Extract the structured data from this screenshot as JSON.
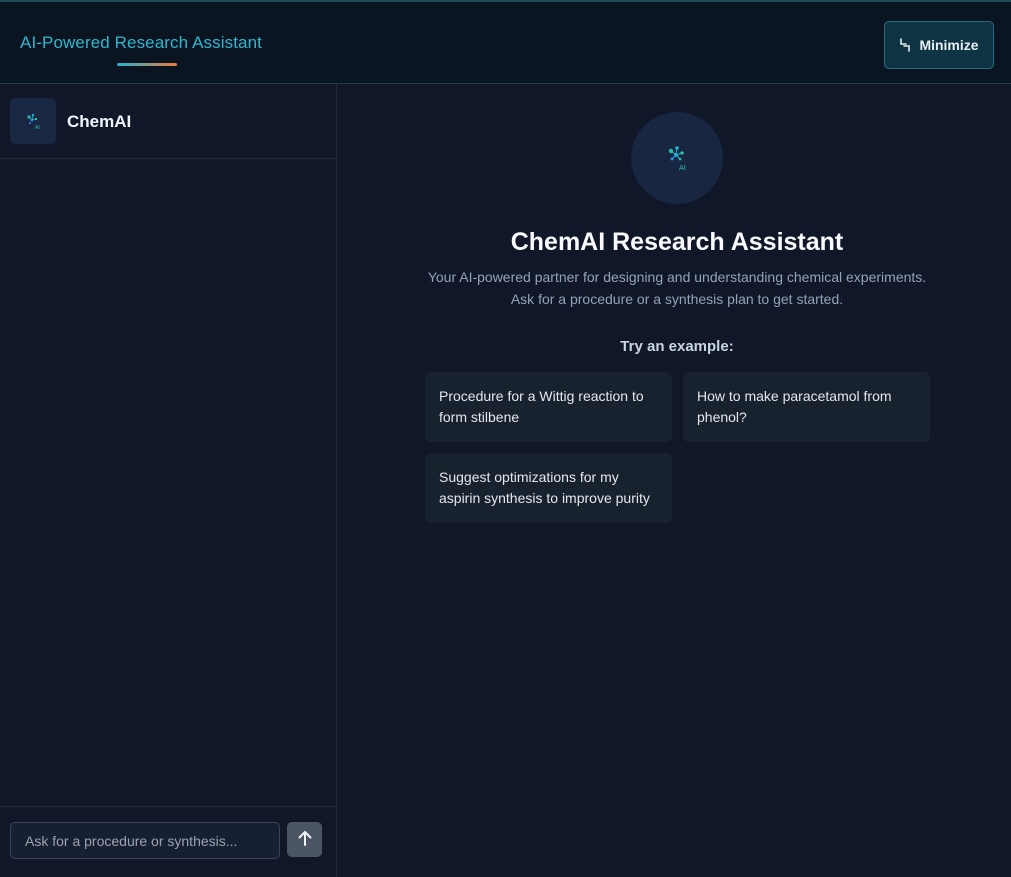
{
  "header": {
    "title": "AI-Powered Research Assistant",
    "minimize_label": "Minimize",
    "minimize_icon": "minimize-icon",
    "accent_gradient": [
      "#22b3d1",
      "#f07a3a"
    ]
  },
  "sidebar": {
    "brand_name": "ChemAI",
    "brand_logo": "chemai-logo",
    "input": {
      "placeholder": "Ask for a procedure or synthesis...",
      "value": ""
    },
    "send_icon": "arrow-up-icon"
  },
  "main": {
    "logo": "chemai-logo",
    "logo_text": "AI",
    "title": "ChemAI Research Assistant",
    "subtitle_line1": "Your AI-powered partner for designing and understanding chemical experiments.",
    "subtitle_line2": "Ask for a procedure or a synthesis plan to get started.",
    "examples_heading": "Try an example:",
    "examples": [
      {
        "label": "Procedure for a Wittig reaction to form stilbene"
      },
      {
        "label": "How to make paracetamol from phenol?"
      },
      {
        "label": "Suggest optimizations for my aspirin synthesis to improve purity"
      }
    ]
  },
  "colors": {
    "background": "#0f1729",
    "header_bg": "#0b1522",
    "accent": "#2fb6cf",
    "card_bg": "#18222f"
  }
}
